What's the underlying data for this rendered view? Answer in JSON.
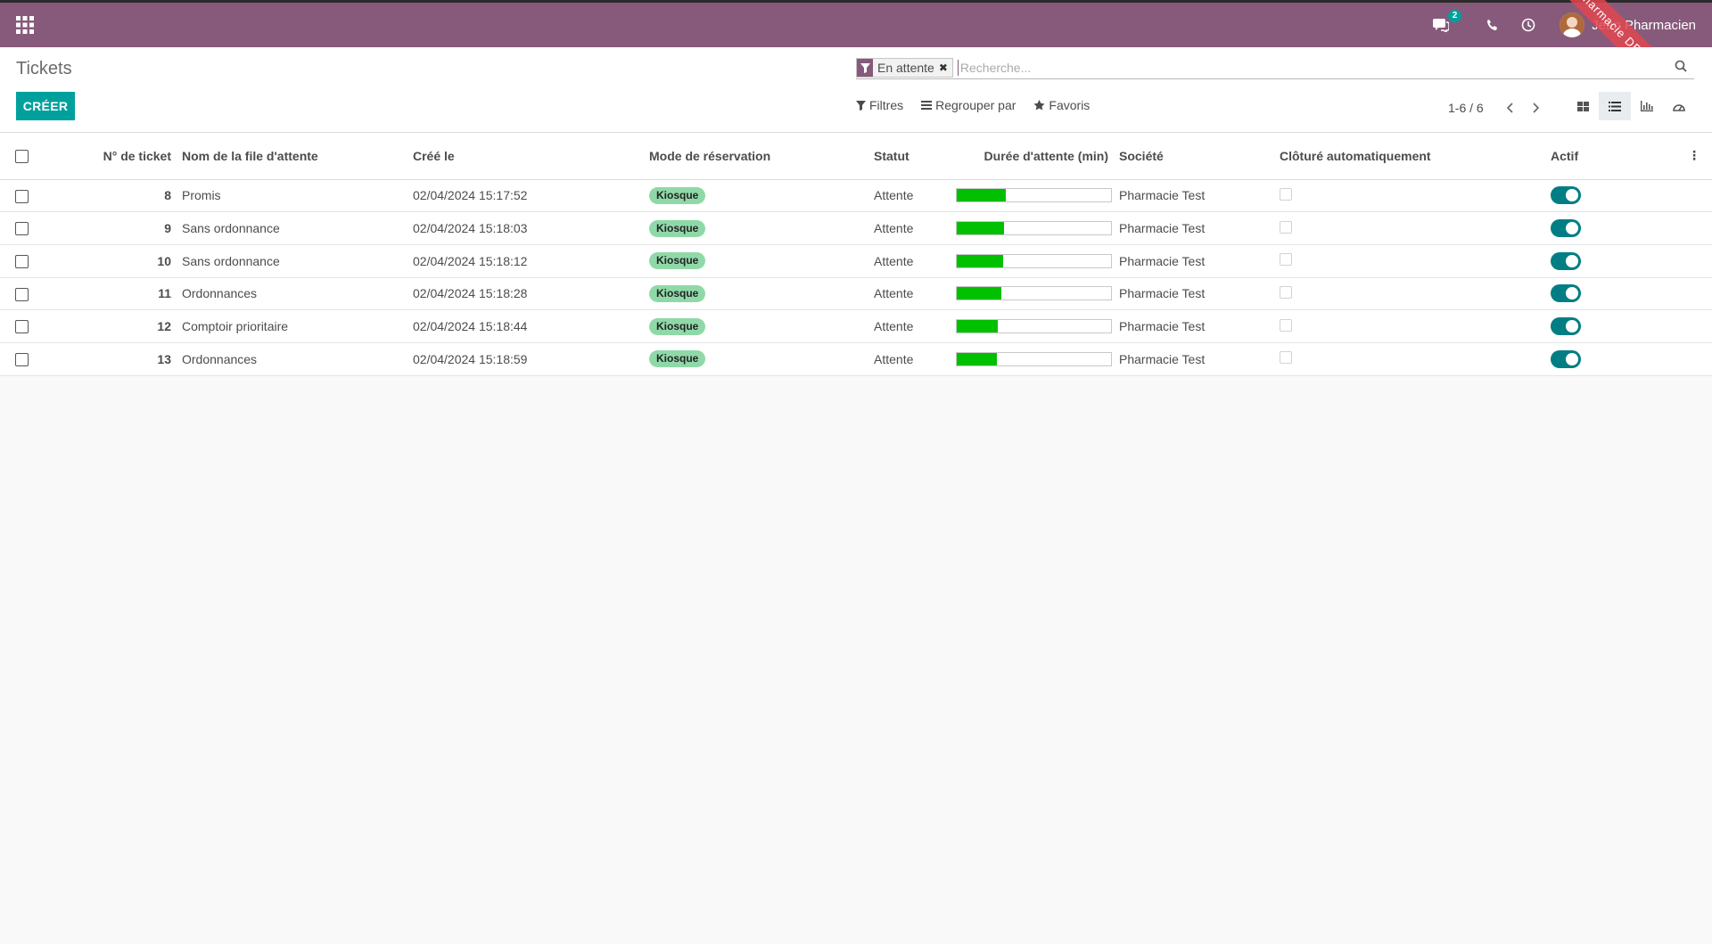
{
  "navbar": {
    "apps_icon": "apps-grid-icon",
    "chat_badge": "2",
    "user_name": "Jean Pharmacien",
    "ribbon_text": "Pharmacie DEMONSTRATION"
  },
  "control_panel": {
    "title": "Tickets",
    "create_label": "CRÉER",
    "facet_value": "En attente",
    "search_placeholder": "Recherche...",
    "filters_label": "Filtres",
    "group_label": "Regrouper par",
    "favorites_label": "Favoris",
    "pager_value": "1-6 / 6"
  },
  "table": {
    "headers": {
      "ticket": "N° de ticket",
      "queue": "Nom de la file d'attente",
      "created": "Créé le",
      "mode": "Mode de réservation",
      "status": "Statut",
      "wait": "Durée d'attente (min)",
      "company": "Société",
      "autoclose": "Clôturé automatiquement",
      "active": "Actif"
    },
    "rows": [
      {
        "ticket": "8",
        "queue": "Promis",
        "created": "02/04/2024 15:17:52",
        "mode": "Kiosque",
        "status": "Attente",
        "wait_fraction": 0.32,
        "company": "Pharmacie Test"
      },
      {
        "ticket": "9",
        "queue": "Sans ordonnance",
        "created": "02/04/2024 15:18:03",
        "mode": "Kiosque",
        "status": "Attente",
        "wait_fraction": 0.31,
        "company": "Pharmacie Test"
      },
      {
        "ticket": "10",
        "queue": "Sans ordonnance",
        "created": "02/04/2024 15:18:12",
        "mode": "Kiosque",
        "status": "Attente",
        "wait_fraction": 0.3,
        "company": "Pharmacie Test"
      },
      {
        "ticket": "11",
        "queue": "Ordonnances",
        "created": "02/04/2024 15:18:28",
        "mode": "Kiosque",
        "status": "Attente",
        "wait_fraction": 0.29,
        "company": "Pharmacie Test"
      },
      {
        "ticket": "12",
        "queue": "Comptoir prioritaire",
        "created": "02/04/2024 15:18:44",
        "mode": "Kiosque",
        "status": "Attente",
        "wait_fraction": 0.27,
        "company": "Pharmacie Test"
      },
      {
        "ticket": "13",
        "queue": "Ordonnances",
        "created": "02/04/2024 15:18:59",
        "mode": "Kiosque",
        "status": "Attente",
        "wait_fraction": 0.26,
        "company": "Pharmacie Test"
      }
    ]
  },
  "colors": {
    "brand": "#875a7b",
    "primary": "#00a09d",
    "toggle": "#017e84",
    "progress": "#00c000",
    "tag": "#8fd9a8"
  }
}
